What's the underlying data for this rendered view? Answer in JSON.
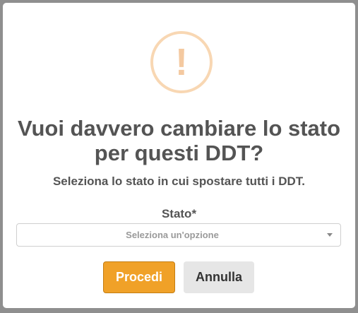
{
  "dialog": {
    "icon": "warning-icon",
    "icon_glyph": "!",
    "title": "Vuoi davvero cambiare lo stato per questi DDT?",
    "subtitle": "Seleziona lo stato in cui spostare tutti i DDT.",
    "field_label": "Stato*",
    "select": {
      "selected_value": "Seleziona un'opzione"
    },
    "buttons": {
      "confirm": "Procedi",
      "cancel": "Annulla"
    }
  },
  "colors": {
    "accent": "#f0a128",
    "warning_icon": "#f4c9a0",
    "text": "#545454"
  }
}
